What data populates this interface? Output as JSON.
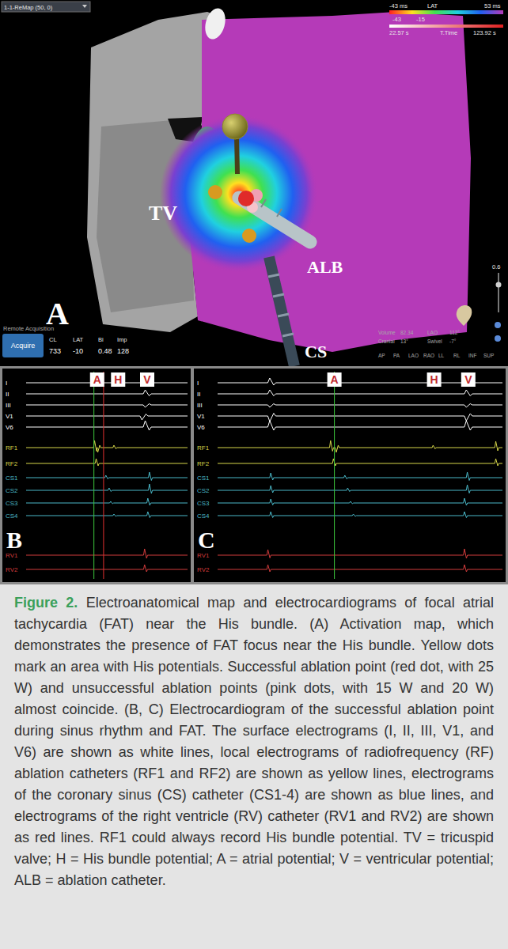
{
  "map": {
    "label": "A",
    "header": "1-1-ReMap (50, 0)",
    "legend": {
      "min": "-43 ms",
      "title": "LAT",
      "max": "53 ms",
      "low": "-43",
      "high": "-15",
      "start": "22.57 s",
      "timer": "T.Time",
      "end": "123.92 s"
    },
    "structures": [
      "TV",
      "ALB",
      "CS"
    ],
    "points": [
      {
        "kind": "his-stalk",
        "color": "#8f8a2a"
      },
      {
        "kind": "his",
        "color": "#d89a20"
      },
      {
        "kind": "his",
        "color": "#d89a20"
      },
      {
        "kind": "fail",
        "color": "#f0a0b4"
      },
      {
        "kind": "fail",
        "color": "#f5c4cc"
      },
      {
        "kind": "success",
        "color": "#e02a2a"
      }
    ],
    "acquisition": {
      "caption": "Remote Acquisition",
      "button": "Acquire",
      "readings": [
        {
          "name": "CL",
          "value": "733"
        },
        {
          "name": "LAT",
          "value": "-10"
        },
        {
          "name": "Bi",
          "value": "0.48"
        },
        {
          "name": "Imp",
          "value": "128"
        }
      ]
    },
    "orientation": [
      {
        "name": "Volume",
        "value": "82.34"
      },
      {
        "name": "LAO",
        "value": "112°"
      },
      {
        "name": "Cranial",
        "value": "13°"
      },
      {
        "name": "Swivel",
        "value": "-7°"
      }
    ],
    "views": [
      "AP",
      "PA",
      "LAO",
      "RAO",
      "LL",
      "RL",
      "INF",
      "SUP"
    ],
    "opacity": {
      "reading": "0.6",
      "level": 0.7
    }
  },
  "panels": [
    {
      "label": "B",
      "markers": [
        {
          "label": "A",
          "at": 0.44
        },
        {
          "label": "H",
          "at": 0.57
        },
        {
          "label": "V",
          "at": 0.75
        }
      ],
      "cursors": [
        {
          "color": "#3cc83c",
          "at": 0.42
        },
        {
          "color": "#e03030",
          "at": 0.48
        }
      ],
      "channels": [
        {
          "name": "I",
          "kind": "surface",
          "color": "#ffffff",
          "peaks": [
            {
              "at": 0.75,
              "amp": 6
            }
          ]
        },
        {
          "name": "II",
          "kind": "surface",
          "color": "#ffffff",
          "peaks": [
            {
              "at": 0.75,
              "amp": 5
            }
          ]
        },
        {
          "name": "III",
          "kind": "surface",
          "color": "#ffffff",
          "peaks": [
            {
              "at": 0.75,
              "amp": -3
            }
          ]
        },
        {
          "name": "V1",
          "kind": "surface",
          "color": "#ffffff",
          "peaks": [
            {
              "at": 0.73,
              "amp": -5
            }
          ]
        },
        {
          "name": "V6",
          "kind": "surface",
          "color": "#ffffff",
          "peaks": [
            {
              "at": 0.75,
              "amp": 8
            }
          ]
        },
        {
          "name": "RF1",
          "kind": "intracardiac",
          "color": "#d6d64a",
          "peaks": [
            {
              "at": 0.43,
              "amp": 9
            },
            {
              "at": 0.45,
              "amp": -6
            },
            {
              "at": 0.55,
              "amp": 3
            }
          ]
        },
        {
          "name": "RF2",
          "kind": "intracardiac",
          "color": "#d6d64a",
          "peaks": [
            {
              "at": 0.44,
              "amp": 6
            }
          ]
        },
        {
          "name": "CS1",
          "kind": "intracardiac",
          "color": "#4ab8c8",
          "peaks": [
            {
              "at": 0.5,
              "amp": 3
            },
            {
              "at": 0.77,
              "amp": 7
            }
          ]
        },
        {
          "name": "CS2",
          "kind": "intracardiac",
          "color": "#4ab8c8",
          "peaks": [
            {
              "at": 0.52,
              "amp": 3
            },
            {
              "at": 0.77,
              "amp": 8
            }
          ]
        },
        {
          "name": "CS3",
          "kind": "intracardiac",
          "color": "#4ab8c8",
          "peaks": [
            {
              "at": 0.53,
              "amp": 2
            },
            {
              "at": 0.76,
              "amp": 6
            }
          ]
        },
        {
          "name": "CS4",
          "kind": "intracardiac",
          "color": "#4ab8c8",
          "peaks": [
            {
              "at": 0.55,
              "amp": 2
            },
            {
              "at": 0.76,
              "amp": 5
            }
          ]
        },
        {
          "name": "RV1",
          "kind": "intracardiac",
          "color": "#d23c3c",
          "peaks": [
            {
              "at": 0.74,
              "amp": 8
            }
          ]
        },
        {
          "name": "RV2",
          "kind": "intracardiac",
          "color": "#d23c3c",
          "peaks": [
            {
              "at": 0.74,
              "amp": 6
            }
          ]
        }
      ]
    },
    {
      "label": "C",
      "markers": [
        {
          "label": "A",
          "at": 0.41
        },
        {
          "label": "H",
          "at": 0.76
        },
        {
          "label": "V",
          "at": 0.88
        }
      ],
      "cursors": [
        {
          "color": "#3cc83c",
          "at": 0.41
        }
      ],
      "channels": [
        {
          "name": "I",
          "kind": "surface",
          "color": "#ffffff",
          "peaks": [
            {
              "at": 0.19,
              "amp": 6
            },
            {
              "at": 0.88,
              "amp": 6
            }
          ]
        },
        {
          "name": "II",
          "kind": "surface",
          "color": "#ffffff",
          "peaks": [
            {
              "at": 0.19,
              "amp": 5
            },
            {
              "at": 0.88,
              "amp": 5
            }
          ]
        },
        {
          "name": "III",
          "kind": "surface",
          "color": "#ffffff",
          "peaks": [
            {
              "at": 0.19,
              "amp": -3
            },
            {
              "at": 0.88,
              "amp": -3
            }
          ]
        },
        {
          "name": "V1",
          "kind": "surface",
          "color": "#ffffff",
          "peaks": [
            {
              "at": 0.19,
              "amp": -7
            },
            {
              "at": 0.88,
              "amp": -6
            }
          ]
        },
        {
          "name": "V6",
          "kind": "surface",
          "color": "#ffffff",
          "peaks": [
            {
              "at": 0.19,
              "amp": 8
            },
            {
              "at": 0.88,
              "amp": 8
            }
          ]
        },
        {
          "name": "RF1",
          "kind": "intracardiac",
          "color": "#d6d64a",
          "peaks": [
            {
              "at": 0.4,
              "amp": 9
            },
            {
              "at": 0.42,
              "amp": -6
            },
            {
              "at": 0.76,
              "amp": 3
            },
            {
              "at": 0.98,
              "amp": 8
            }
          ]
        },
        {
          "name": "RF2",
          "kind": "intracardiac",
          "color": "#d6d64a",
          "peaks": [
            {
              "at": 0.41,
              "amp": 6
            },
            {
              "at": 0.98,
              "amp": 6
            }
          ]
        },
        {
          "name": "CS1",
          "kind": "intracardiac",
          "color": "#4ab8c8",
          "peaks": [
            {
              "at": 0.19,
              "amp": 6
            },
            {
              "at": 0.45,
              "amp": 3
            },
            {
              "at": 0.88,
              "amp": 7
            }
          ]
        },
        {
          "name": "CS2",
          "kind": "intracardiac",
          "color": "#4ab8c8",
          "peaks": [
            {
              "at": 0.19,
              "amp": 6
            },
            {
              "at": 0.46,
              "amp": 3
            },
            {
              "at": 0.88,
              "amp": 7
            }
          ]
        },
        {
          "name": "CS3",
          "kind": "intracardiac",
          "color": "#4ab8c8",
          "peaks": [
            {
              "at": 0.19,
              "amp": 5
            },
            {
              "at": 0.47,
              "amp": 2
            },
            {
              "at": 0.87,
              "amp": 6
            }
          ]
        },
        {
          "name": "CS4",
          "kind": "intracardiac",
          "color": "#4ab8c8",
          "peaks": [
            {
              "at": 0.19,
              "amp": 5
            },
            {
              "at": 0.48,
              "amp": 2
            },
            {
              "at": 0.87,
              "amp": 5
            }
          ]
        },
        {
          "name": "RV1",
          "kind": "intracardiac",
          "color": "#d23c3c",
          "peaks": [
            {
              "at": 0.18,
              "amp": 7
            },
            {
              "at": 0.87,
              "amp": 8
            }
          ]
        },
        {
          "name": "RV2",
          "kind": "intracardiac",
          "color": "#d23c3c",
          "peaks": [
            {
              "at": 0.18,
              "amp": 6
            },
            {
              "at": 0.87,
              "amp": 6
            }
          ]
        }
      ]
    }
  ],
  "caption": {
    "title": "Figure 2.",
    "text": "Electroanatomical map and electrocardiograms of focal atrial tachycardia (FAT) near the His bundle. (A) Activation map, which demonstrates the presence of FAT focus near the His bundle. Yellow dots mark an area with His potentials. Successful ablation point (red dot, with 25 W) and unsuccessful ablation points (pink dots, with 15 W and 20 W) almost coincide. (B, C) Electrocardiogram of the successful ablation point during sinus rhythm and FAT. The surface electrograms (I, II, III, V1, and V6) are shown as white lines, local electrograms of radiofrequency (RF) ablation catheters (RF1 and RF2) are shown as yellow lines, electrograms of the coronary sinus (CS) catheter (CS1-4) are shown as blue lines, and electrograms of the right ventricle (RV) catheter (RV1 and RV2) are shown as red lines. RF1 could always record His bundle potential. TV = tricuspid valve; H = His bundle potential; A = atrial potential; V = ventricular potential; ALB = ablation catheter."
  }
}
